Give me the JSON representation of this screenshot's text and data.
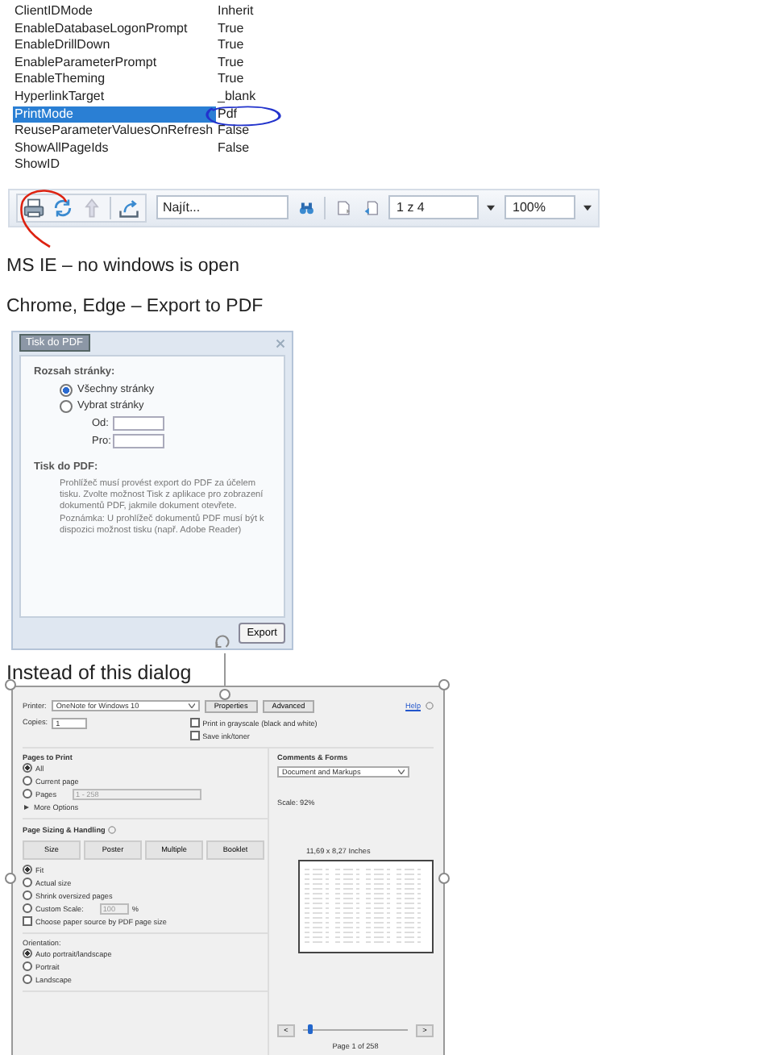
{
  "property_grid": {
    "rows": [
      {
        "name": "ClientIDMode",
        "value": "Inherit",
        "selected": false
      },
      {
        "name": "EnableDatabaseLogonPrompt",
        "value": "True",
        "selected": false
      },
      {
        "name": "EnableDrillDown",
        "value": "True",
        "selected": false
      },
      {
        "name": "EnableParameterPrompt",
        "value": "True",
        "selected": false
      },
      {
        "name": "EnableTheming",
        "value": "True",
        "selected": false
      },
      {
        "name": "HyperlinkTarget",
        "value": "_blank",
        "selected": false
      },
      {
        "name": "PrintMode",
        "value": "Pdf",
        "selected": true
      },
      {
        "name": "ReuseParameterValuesOnRefresh",
        "value": "False",
        "selected": false
      },
      {
        "name": "ShowAllPageIds",
        "value": "False",
        "selected": false
      },
      {
        "name": "ShowID",
        "selected": false
      }
    ]
  },
  "toolbar": {
    "find_placeholder": "Najít...",
    "page": "1 z 4",
    "zoom": "100%"
  },
  "notes": [
    "MS IE – no windows is open",
    "Chrome, Edge – Export to PDF"
  ],
  "export_dialog": {
    "title": "Tisk do PDF",
    "range_heading": "Rozsah stránky:",
    "options": [
      {
        "label": "Všechny stránky",
        "selected": true
      },
      {
        "label": "Vybrat stránky",
        "selected": false
      }
    ],
    "from_label": "Od:",
    "to_label": "Pro:",
    "print_heading": "Tisk do PDF:",
    "message": "Prohlížeč musí provést export do PDF za účelem tisku. Zvolte možnost Tisk z aplikace pro zobrazení dokumentů PDF, jakmile dokument otevřete. Poznámka: U prohlížeč dokumentů PDF musí být k dispozici možnost tisku (např. Adobe Reader)",
    "export_button": "Export"
  },
  "caption": "Instead of this dialog",
  "print_dialog": {
    "printer_label": "Printer:",
    "printer": "OneNote for Windows 10",
    "buttons": [
      "Properties",
      "Advanced"
    ],
    "help": "Help",
    "copies_label": "Copies:",
    "copies": "1",
    "checkboxes": [
      {
        "label": "Print in grayscale (black and white)",
        "checked": false
      },
      {
        "label": "Save ink/toner",
        "checked": false
      }
    ],
    "pages_heading": "Pages to Print",
    "pages_options": [
      {
        "label": "All",
        "selected": true
      },
      {
        "label": "Current page",
        "selected": false
      },
      {
        "label": "Pages",
        "selected": false,
        "placeholder": "1 - 258"
      }
    ],
    "more_options": "More Options",
    "sizing_heading": "Page Sizing & Handling",
    "sizing_buttons": [
      "Size",
      "Poster",
      "Multiple",
      "Booklet"
    ],
    "fit_options": [
      {
        "label": "Fit",
        "selected": true
      },
      {
        "label": "Actual size",
        "selected": false
      },
      {
        "label": "Shrink oversized pages",
        "selected": false
      },
      {
        "label": "Custom Scale:",
        "selected": false,
        "placeholder": "100",
        "unit": "%"
      }
    ],
    "paper_source": {
      "label": "Choose paper source by PDF page size",
      "checked": false
    },
    "orientation_heading": "Orientation:",
    "orientation_options": [
      {
        "label": "Auto portrait/landscape",
        "selected": true
      },
      {
        "label": "Portrait",
        "selected": false
      },
      {
        "label": "Landscape",
        "selected": false
      }
    ],
    "comments_heading": "Comments & Forms",
    "comments_value": "Document and Markups",
    "scale_text": "Scale: 92%",
    "paper_size": "11,69 x 8,27 Inches",
    "prev": "<",
    "next": ">",
    "page_slider": {
      "level": 0.05
    },
    "page_label": "Page 1 of 258"
  }
}
